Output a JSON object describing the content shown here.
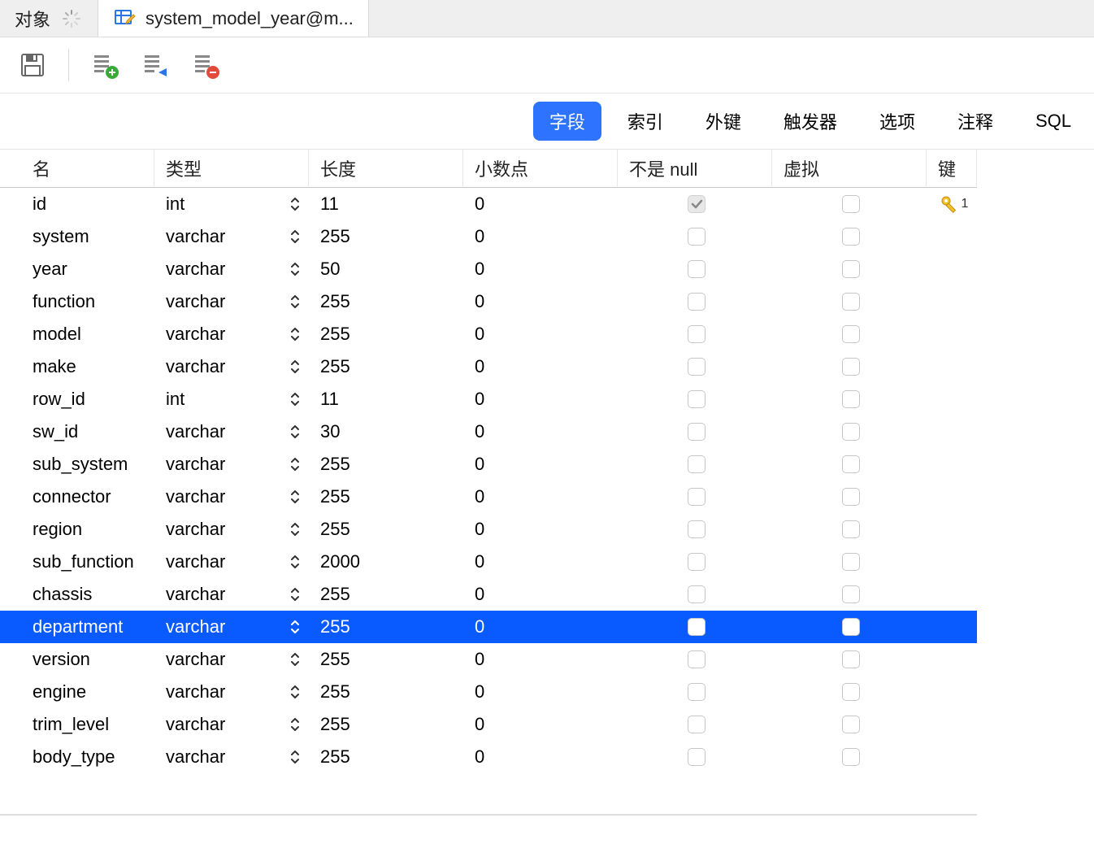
{
  "tabs": {
    "objects": {
      "label": "对象"
    },
    "current": {
      "label": "system_model_year@m..."
    }
  },
  "innerTabs": {
    "fields": "字段",
    "indexes": "索引",
    "foreignKeys": "外键",
    "triggers": "触发器",
    "options": "选项",
    "comments": "注释",
    "sql": "SQL"
  },
  "columns": {
    "name": "名",
    "type": "类型",
    "length": "长度",
    "decimal": "小数点",
    "notNull": "不是 null",
    "virtual": "虚拟",
    "key": "键"
  },
  "rows": [
    {
      "name": "id",
      "type": "int",
      "length": "11",
      "decimal": "0",
      "notNull": true,
      "notNullDisabled": true,
      "virtual": false,
      "key": "1",
      "selected": false
    },
    {
      "name": "system",
      "type": "varchar",
      "length": "255",
      "decimal": "0",
      "notNull": false,
      "virtual": false,
      "key": "",
      "selected": false
    },
    {
      "name": "year",
      "type": "varchar",
      "length": "50",
      "decimal": "0",
      "notNull": false,
      "virtual": false,
      "key": "",
      "selected": false
    },
    {
      "name": "function",
      "type": "varchar",
      "length": "255",
      "decimal": "0",
      "notNull": false,
      "virtual": false,
      "key": "",
      "selected": false
    },
    {
      "name": "model",
      "type": "varchar",
      "length": "255",
      "decimal": "0",
      "notNull": false,
      "virtual": false,
      "key": "",
      "selected": false
    },
    {
      "name": "make",
      "type": "varchar",
      "length": "255",
      "decimal": "0",
      "notNull": false,
      "virtual": false,
      "key": "",
      "selected": false
    },
    {
      "name": "row_id",
      "type": "int",
      "length": "11",
      "decimal": "0",
      "notNull": false,
      "virtual": false,
      "key": "",
      "selected": false
    },
    {
      "name": "sw_id",
      "type": "varchar",
      "length": "30",
      "decimal": "0",
      "notNull": false,
      "virtual": false,
      "key": "",
      "selected": false
    },
    {
      "name": "sub_system",
      "type": "varchar",
      "length": "255",
      "decimal": "0",
      "notNull": false,
      "virtual": false,
      "key": "",
      "selected": false
    },
    {
      "name": "connector",
      "type": "varchar",
      "length": "255",
      "decimal": "0",
      "notNull": false,
      "virtual": false,
      "key": "",
      "selected": false
    },
    {
      "name": "region",
      "type": "varchar",
      "length": "255",
      "decimal": "0",
      "notNull": false,
      "virtual": false,
      "key": "",
      "selected": false
    },
    {
      "name": "sub_function",
      "type": "varchar",
      "length": "2000",
      "decimal": "0",
      "notNull": false,
      "virtual": false,
      "key": "",
      "selected": false
    },
    {
      "name": "chassis",
      "type": "varchar",
      "length": "255",
      "decimal": "0",
      "notNull": false,
      "virtual": false,
      "key": "",
      "selected": false
    },
    {
      "name": "department",
      "type": "varchar",
      "length": "255",
      "decimal": "0",
      "notNull": false,
      "virtual": false,
      "key": "",
      "selected": true
    },
    {
      "name": "version",
      "type": "varchar",
      "length": "255",
      "decimal": "0",
      "notNull": false,
      "virtual": false,
      "key": "",
      "selected": false
    },
    {
      "name": "engine",
      "type": "varchar",
      "length": "255",
      "decimal": "0",
      "notNull": false,
      "virtual": false,
      "key": "",
      "selected": false
    },
    {
      "name": "trim_level",
      "type": "varchar",
      "length": "255",
      "decimal": "0",
      "notNull": false,
      "virtual": false,
      "key": "",
      "selected": false
    },
    {
      "name": "body_type",
      "type": "varchar",
      "length": "255",
      "decimal": "0",
      "notNull": false,
      "virtual": false,
      "key": "",
      "selected": false
    }
  ]
}
